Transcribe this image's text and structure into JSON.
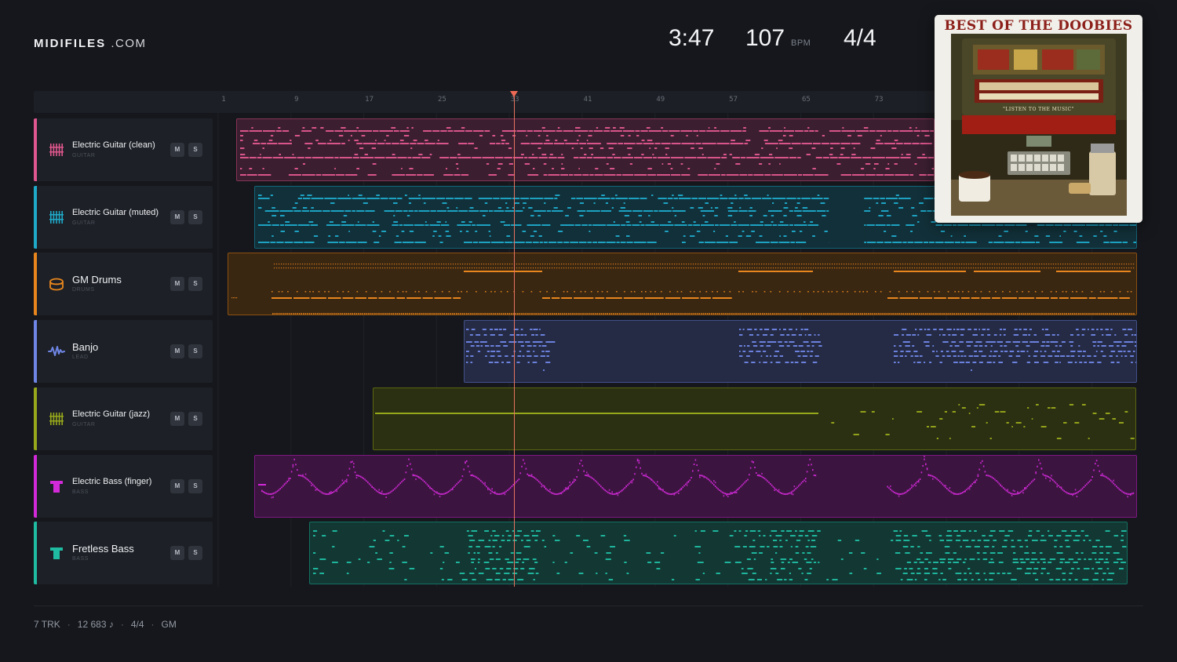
{
  "brand": {
    "name": "MIDIFILES",
    "suffix": ".COM"
  },
  "stats": {
    "time": "3:47",
    "bpm": "107",
    "bpm_unit": "BPM",
    "time_signature": "4/4"
  },
  "ruler": {
    "ticks": [
      "1",
      "9",
      "17",
      "25",
      "33",
      "41",
      "49",
      "57",
      "65",
      "73"
    ]
  },
  "tracks": [
    {
      "name": "Electric Guitar (clean)",
      "category": "GUITAR",
      "color": "#e0578f",
      "clip_fill": "#3b1f31",
      "icon": "guitar-strings-icon"
    },
    {
      "name": "Electric Guitar (muted)",
      "category": "GUITAR",
      "color": "#1fa9c9",
      "clip_fill": "#123039",
      "icon": "guitar-strings-icon"
    },
    {
      "name": "GM Drums",
      "category": "DRUMS",
      "color": "#e8861d",
      "clip_fill": "#3a2712",
      "icon": "drum-icon"
    },
    {
      "name": "Banjo",
      "category": "LEAD",
      "color": "#6f86e6",
      "clip_fill": "#252b45",
      "icon": "waveform-icon"
    },
    {
      "name": "Electric Guitar (jazz)",
      "category": "GUITAR",
      "color": "#97a81b",
      "clip_fill": "#2c3012",
      "icon": "guitar-strings-icon"
    },
    {
      "name": "Electric Bass (finger)",
      "category": "BASS",
      "color": "#d22ad8",
      "clip_fill": "#3c1440",
      "icon": "bass-icon"
    },
    {
      "name": "Fretless Bass",
      "category": "BASS",
      "color": "#1fbca2",
      "clip_fill": "#133733",
      "icon": "bass-icon"
    }
  ],
  "buttons": {
    "mute": "M",
    "solo": "S"
  },
  "album": {
    "title": "BEST OF THE DOOBIES",
    "tagline": "\"LISTEN TO THE MUSIC\""
  },
  "footer": {
    "tracks": "7 TRK",
    "notes": "12 683 ♪",
    "time_signature": "4/4",
    "standard": "GM"
  }
}
